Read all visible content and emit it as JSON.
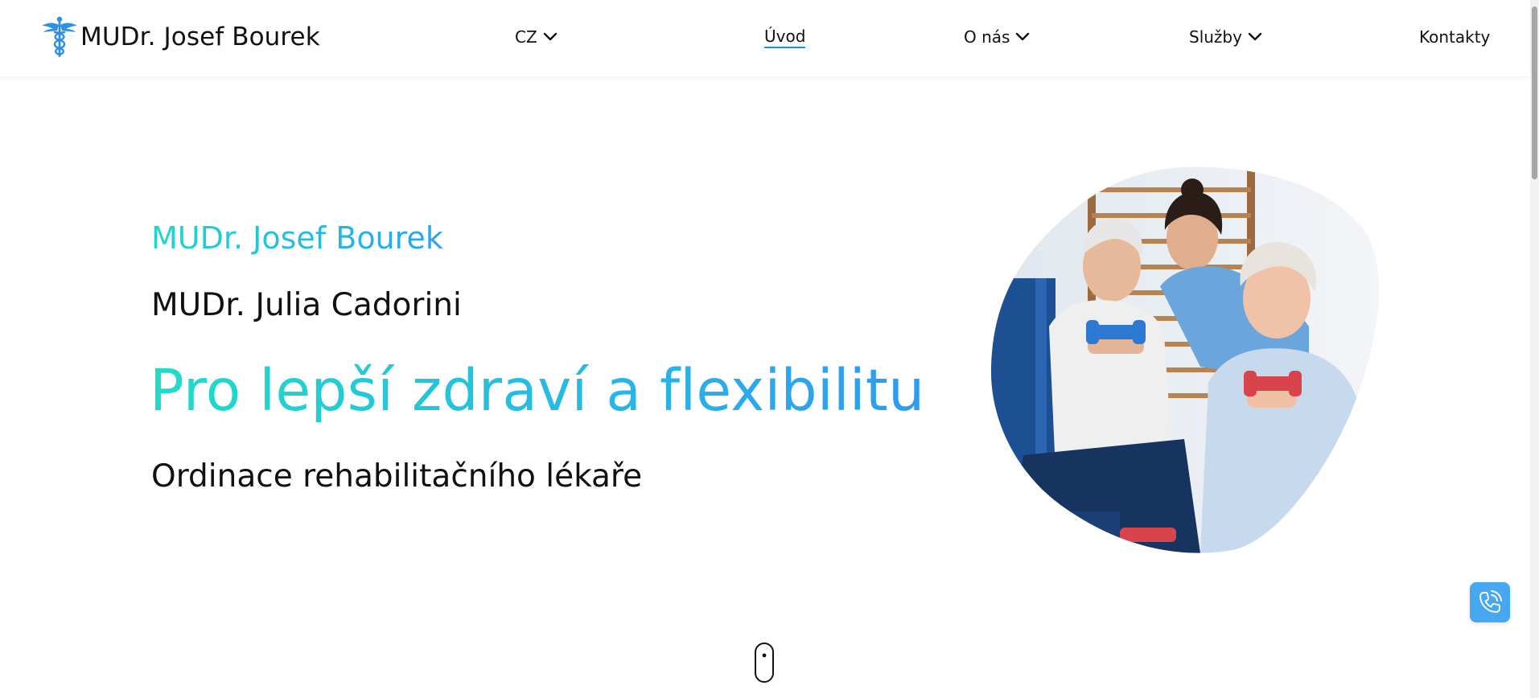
{
  "header": {
    "brand": "MUDr. Josef Bourek",
    "nav": {
      "language": "CZ",
      "home": "Úvod",
      "about": "O nás",
      "services": "Služby",
      "contacts": "Kontakty"
    }
  },
  "hero": {
    "doctor_primary": "MUDr. Josef Bourek",
    "doctor_secondary": "MUDr. Julia Cadorini",
    "headline": "Pro lepší zdraví a flexibilitu",
    "description": "Ordinace rehabilitačního lékaře"
  },
  "icons": {
    "logo": "caduceus-icon",
    "dropdown": "chevron-down-icon",
    "call": "phone-icon",
    "scroll": "mouse-scroll-icon"
  },
  "colors": {
    "accent_start": "#1fdcc8",
    "accent_end": "#2f9af1",
    "call_button": "#47a8f1",
    "active_underline": "#1a8fe0"
  }
}
